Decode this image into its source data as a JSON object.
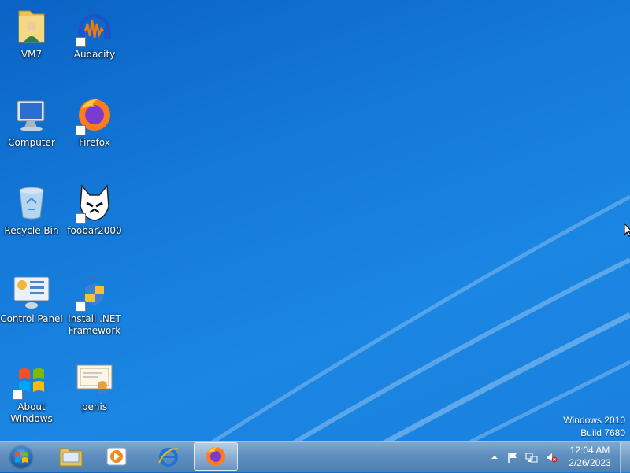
{
  "desktop": {
    "icons": [
      {
        "label": "VM7",
        "icon": "user-folder-icon",
        "shortcut": false
      },
      {
        "label": "Audacity",
        "icon": "audacity-icon",
        "shortcut": true
      },
      {
        "label": "Computer",
        "icon": "computer-icon",
        "shortcut": false
      },
      {
        "label": "Firefox",
        "icon": "firefox-icon",
        "shortcut": true
      },
      {
        "label": "Recycle Bin",
        "icon": "recycle-bin-icon",
        "shortcut": false
      },
      {
        "label": "foobar2000",
        "icon": "foobar2000-icon",
        "shortcut": true
      },
      {
        "label": "Control Panel",
        "icon": "control-panel-icon",
        "shortcut": false
      },
      {
        "label": "Install .NET Framework",
        "icon": "dotnet-installer-icon",
        "shortcut": true
      },
      {
        "label": "About Windows",
        "icon": "windows-logo-icon",
        "shortcut": true
      },
      {
        "label": "penis",
        "icon": "certificate-icon",
        "shortcut": false
      }
    ]
  },
  "watermark": {
    "line1": "Windows 2010",
    "line2": "Build 7680"
  },
  "taskbar": {
    "start_icon": "windows-start-icon",
    "pinned": [
      {
        "name": "file-explorer",
        "icon": "explorer-folder-icon"
      },
      {
        "name": "media-player",
        "icon": "media-player-icon"
      },
      {
        "name": "internet-explorer",
        "icon": "internet-explorer-icon"
      },
      {
        "name": "firefox",
        "icon": "firefox-icon",
        "active": true
      }
    ],
    "tray": {
      "icons": [
        "show-hidden-icons-arrow",
        "action-center-flag-icon",
        "network-icon",
        "volume-muted-icon"
      ],
      "time": "12:04 AM",
      "date": "2/26/2023"
    }
  },
  "colors": {
    "desktop_blue": "#1479d8",
    "taskbar": "#5f8fbf"
  }
}
